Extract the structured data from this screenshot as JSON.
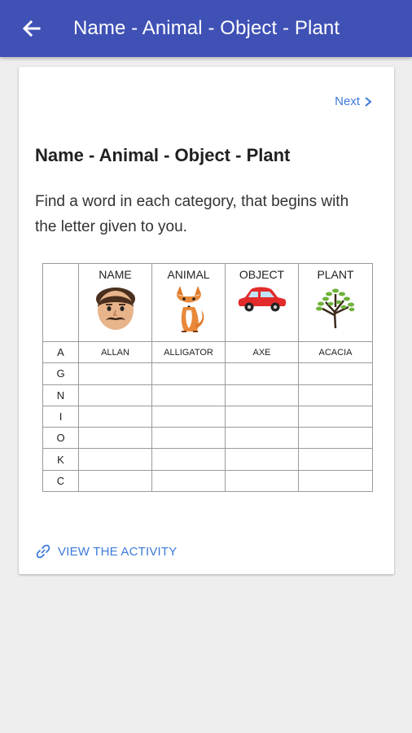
{
  "appbar": {
    "title": "Name - Animal - Object - Plant",
    "back_icon": "arrow-left-icon"
  },
  "card": {
    "next_label": "Next",
    "title": "Name - Animal - Object - Plant",
    "description": "Find a word in each category, that begins with the letter given to you.",
    "activity_link": "VIEW THE ACTIVITY",
    "colors": {
      "accent": "#3d7ad8",
      "appbar": "#3f51b5"
    }
  },
  "worksheet": {
    "headers": [
      "NAME",
      "ANIMAL",
      "OBJECT",
      "PLANT"
    ],
    "header_icons": [
      "face-icon",
      "fox-icon",
      "car-icon",
      "tree-icon"
    ],
    "rows": [
      {
        "letter": "A",
        "cells": [
          "ALLAN",
          "ALLIGATOR",
          "AXE",
          "ACACIA"
        ]
      },
      {
        "letter": "G",
        "cells": [
          "",
          "",
          "",
          ""
        ]
      },
      {
        "letter": "N",
        "cells": [
          "",
          "",
          "",
          ""
        ]
      },
      {
        "letter": "I",
        "cells": [
          "",
          "",
          "",
          ""
        ]
      },
      {
        "letter": "O",
        "cells": [
          "",
          "",
          "",
          ""
        ]
      },
      {
        "letter": "K",
        "cells": [
          "",
          "",
          "",
          ""
        ]
      },
      {
        "letter": "C",
        "cells": [
          "",
          "",
          "",
          ""
        ]
      }
    ]
  }
}
